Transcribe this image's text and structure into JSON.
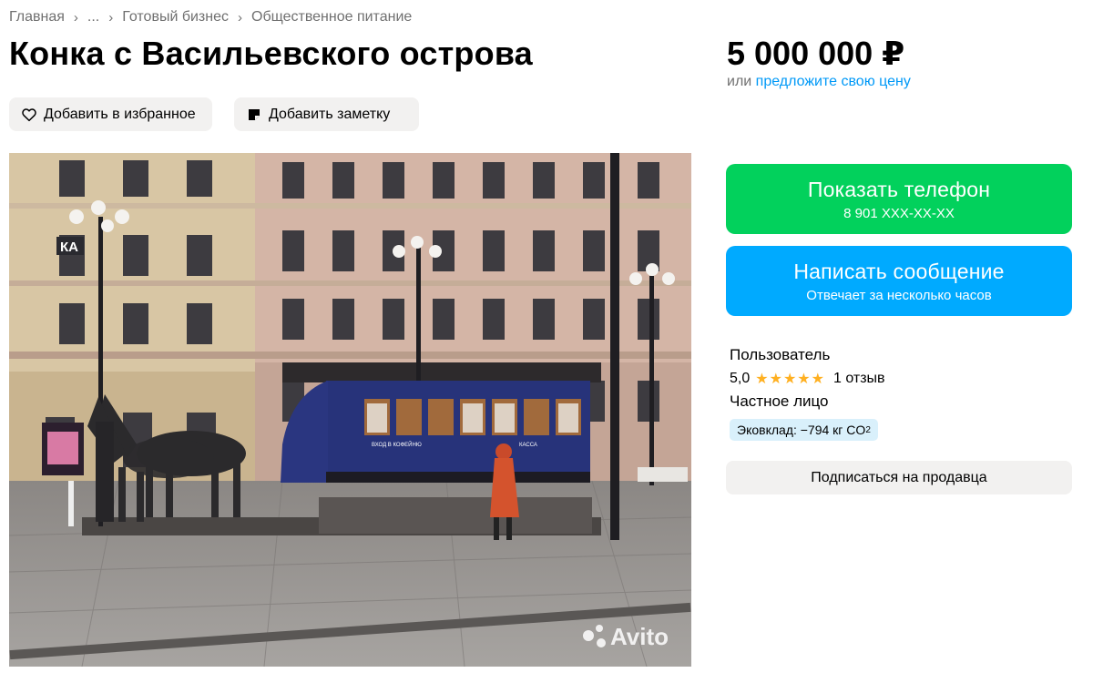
{
  "breadcrumb": {
    "items": [
      "Главная",
      "...",
      "Готовый бизнес",
      "Общественное питание"
    ]
  },
  "listing": {
    "title": "Конка с Васильевского острова",
    "price": "5 000 000 ₽",
    "offer_prefix": "или",
    "offer_link": "предложите свою цену"
  },
  "actions": {
    "favorite": "Добавить в избранное",
    "note": "Добавить заметку"
  },
  "contact": {
    "phone_title": "Показать телефон",
    "phone_number": "8 901 XXX-XX-XX",
    "message_title": "Написать сообщение",
    "message_sub": "Отвечает за несколько часов"
  },
  "seller": {
    "role": "Пользователь",
    "rating": "5,0",
    "stars": "★★★★★",
    "reviews": "1 отзыв",
    "type": "Частное лицо",
    "eco_label": "Эковклад: −794 кг CO",
    "eco_sub": "2",
    "subscribe": "Подписаться на продавца"
  },
  "photo": {
    "watermark": "Avito",
    "sign_ka": "КА",
    "tram_sign_left": "ВХОД В КОФЕЙНЮ",
    "tram_sign_right": "КАССА"
  },
  "colors": {
    "phone_button": "#02d15c",
    "message_button": "#00aaff",
    "link": "#0099f7",
    "star": "#ffb021",
    "eco_badge": "#d9f0fb",
    "tram": "#27337a"
  },
  "icons": {
    "favorite": "heart-outline-icon",
    "note": "note-icon",
    "breadcrumb_separator": "chevron-right-icon"
  }
}
